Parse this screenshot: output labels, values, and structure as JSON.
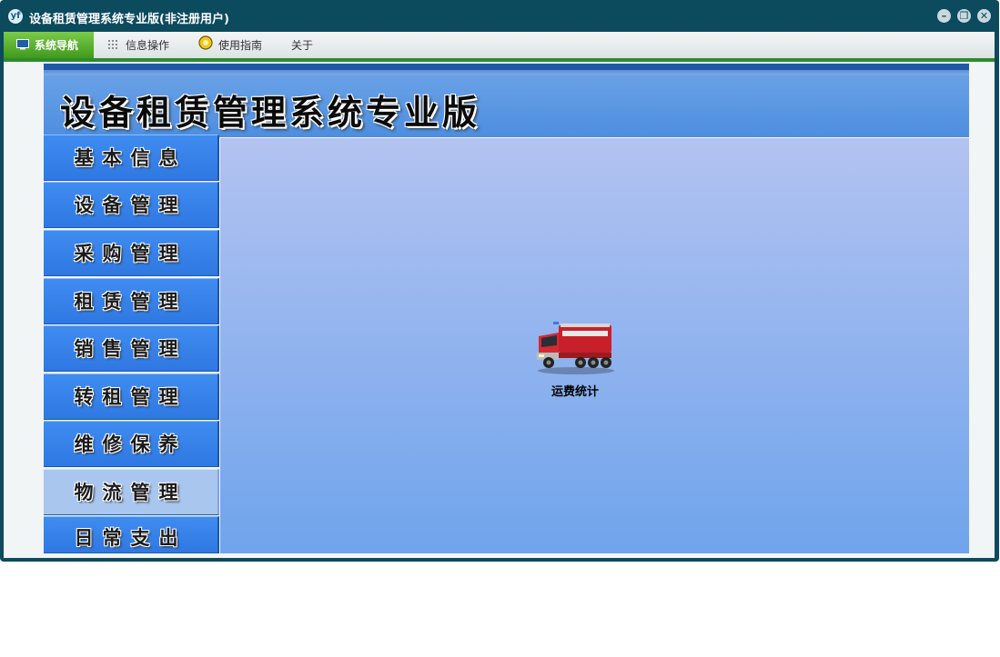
{
  "window": {
    "title": "设备租赁管理系统专业版(非注册用户)",
    "app_icon": "yf"
  },
  "menubar": {
    "items": [
      {
        "label": "系统导航",
        "icon": "monitor-icon",
        "active": true
      },
      {
        "label": "信息操作",
        "icon": "grid-icon",
        "active": false
      },
      {
        "label": "使用指南",
        "icon": "guide-icon",
        "active": false
      },
      {
        "label": "关于",
        "icon": "",
        "active": false
      }
    ]
  },
  "banner": {
    "title": "设备租赁管理系统专业版"
  },
  "sidebar": {
    "items": [
      {
        "label": "基本信息"
      },
      {
        "label": "设备管理"
      },
      {
        "label": "采购管理"
      },
      {
        "label": "租赁管理"
      },
      {
        "label": "销售管理"
      },
      {
        "label": "转租管理"
      },
      {
        "label": "维修保养"
      },
      {
        "label": "物流管理",
        "selected": true
      },
      {
        "label": "日常支出"
      }
    ]
  },
  "main": {
    "tiles": [
      {
        "label": "运费统计",
        "icon": "fire-truck-icon"
      }
    ]
  },
  "colors": {
    "titlebar": "#0c4a5e",
    "menu_accent": "#2e8b2c",
    "banner": "#4d8edf",
    "nav_button": "#2f78e2",
    "nav_selected": "#a9c6ef"
  }
}
